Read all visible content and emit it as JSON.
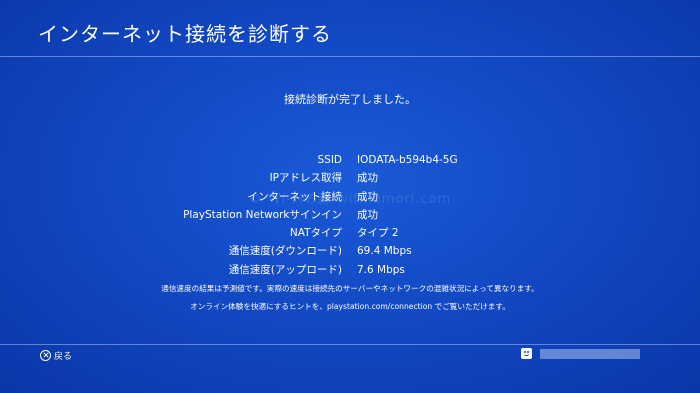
{
  "header": {
    "title": "インターネット接続を診断する"
  },
  "status": {
    "message": "接続診断が完了しました。"
  },
  "results": [
    {
      "label": "SSID",
      "value": "IODATA-b594b4-5G"
    },
    {
      "label": "IPアドレス取得",
      "value": "成功"
    },
    {
      "label": "インターネット接続",
      "value": "成功"
    },
    {
      "label": "PlayStation Networkサインイン",
      "value": "成功"
    },
    {
      "label": "NATタイプ",
      "value": "タイプ 2"
    },
    {
      "label": "通信速度(ダウンロード)",
      "value": "69.4 Mbps"
    },
    {
      "label": "通信速度(アップロード)",
      "value": "7.6 Mbps"
    }
  ],
  "notes": {
    "speed_note": "通信速度の結果は予測値です。実際の速度は接続先のサーバーやネットワークの混雑状況によって異なります。",
    "hint": "オンライン体験を快適にするヒントを、playstation.com/connection でご覧いただけます。"
  },
  "watermark": "© Wi-Fiの森 wifinomori.com",
  "footer": {
    "back_label": "戻る",
    "back_icon": "cross-button-icon",
    "user_icon": "avatar-icon"
  },
  "colors": {
    "background": "#1249c4",
    "text": "#ffffff"
  }
}
